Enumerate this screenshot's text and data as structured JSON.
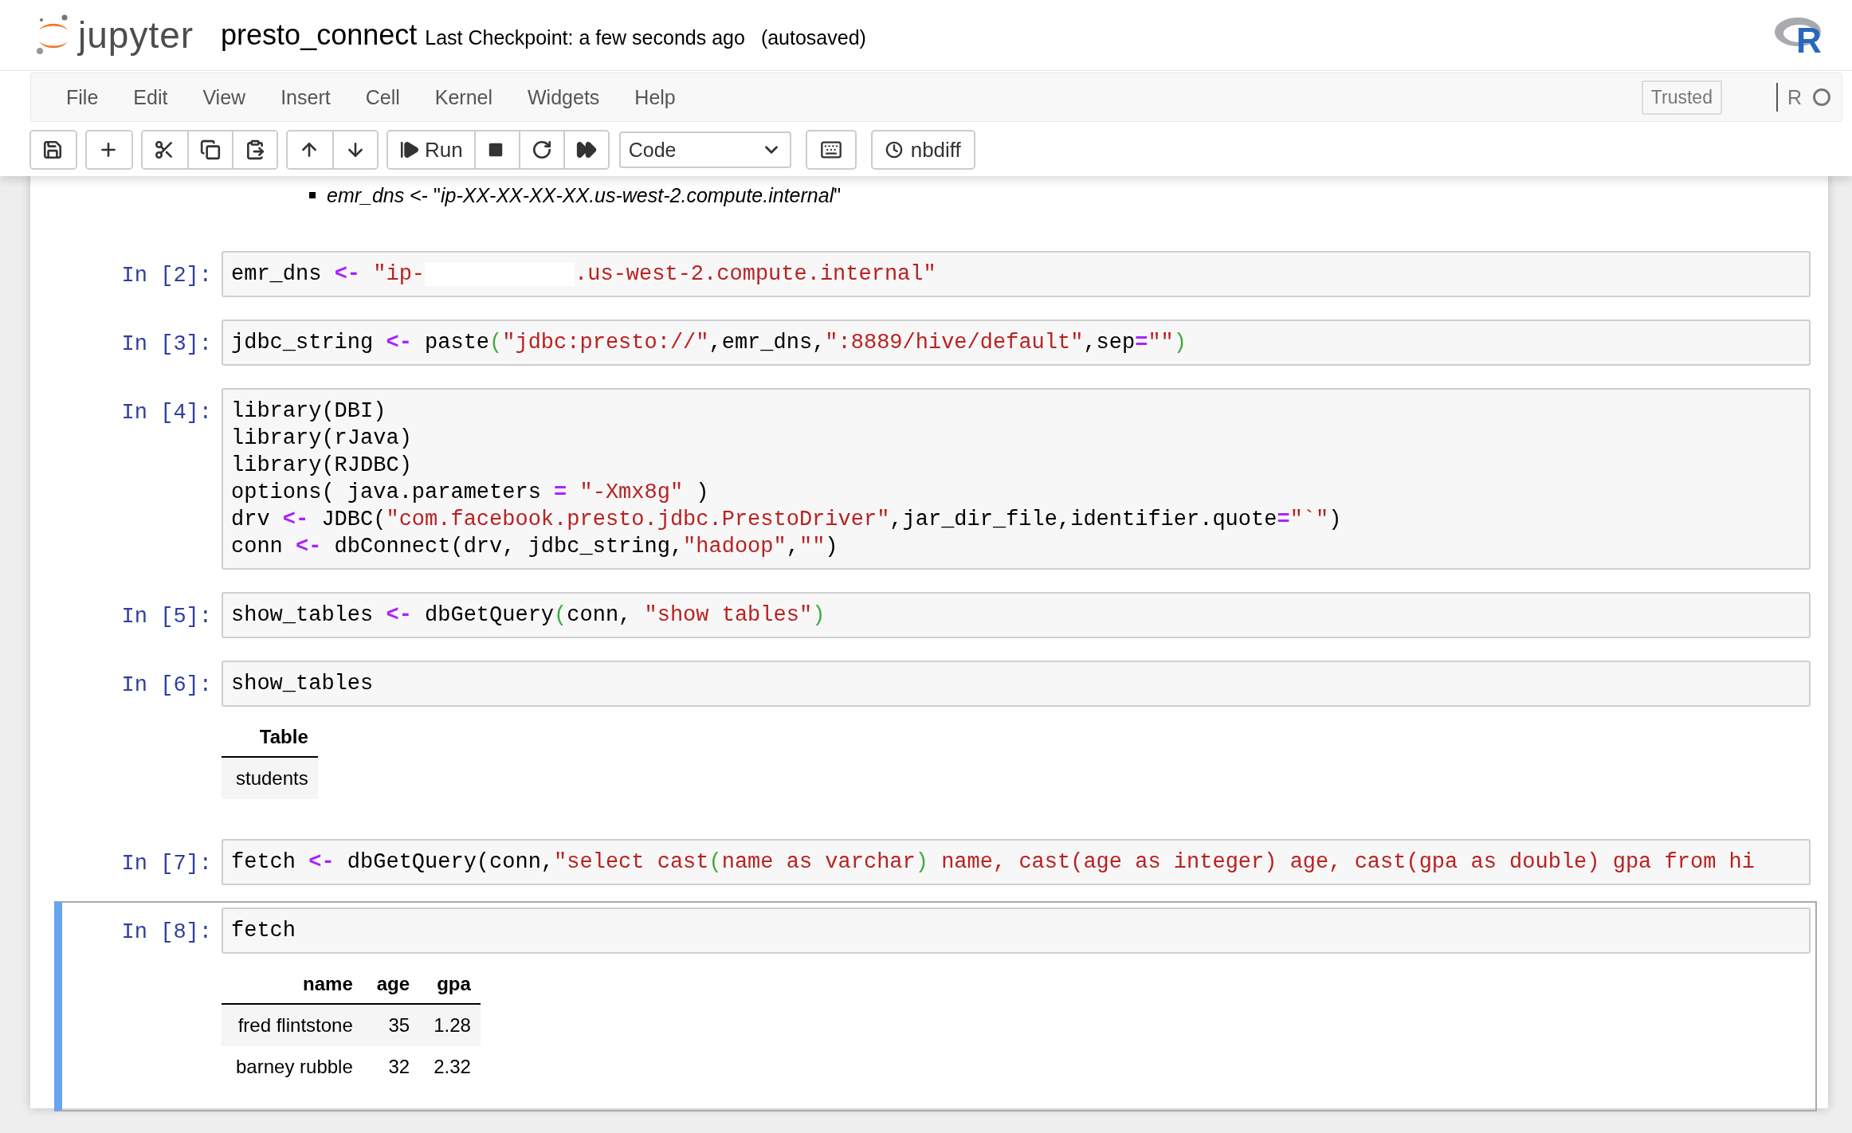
{
  "header": {
    "logo_text": "jupyter",
    "notebook_name": "presto_connect",
    "checkpoint": "Last Checkpoint: a few seconds ago",
    "autosave": "(autosaved)",
    "kernel_logo": {
      "letter": "R"
    }
  },
  "menubar": {
    "items": [
      "File",
      "Edit",
      "View",
      "Insert",
      "Cell",
      "Kernel",
      "Widgets",
      "Help"
    ],
    "trusted": "Trusted",
    "kernel_name": "R",
    "kernel_busy": false
  },
  "toolbar": {
    "groups": [
      [
        {
          "kind": "save"
        }
      ],
      [
        {
          "kind": "add"
        }
      ],
      [
        {
          "kind": "cut"
        },
        {
          "kind": "copy"
        },
        {
          "kind": "paste"
        }
      ],
      [
        {
          "kind": "up"
        },
        {
          "kind": "down"
        }
      ],
      [
        {
          "kind": "run",
          "label": "Run"
        },
        {
          "kind": "stop"
        },
        {
          "kind": "restart"
        },
        {
          "kind": "run_all"
        }
      ]
    ],
    "cell_type": "Code",
    "nbdiff": "nbdiff"
  },
  "markdown": {
    "items": [
      {
        "text": "*emr_dns* <- \"*ip-XX-XX-XX-XX.us-west-2.compute.internal*\""
      }
    ]
  },
  "cells": [
    {
      "prompt": "In [2]:",
      "selected": false,
      "lines": [
        [
          {
            "kind": "plain",
            "text": "emr_dns "
          },
          {
            "kind": "op",
            "text": "<-"
          },
          {
            "kind": "str",
            "text": " \"ip-"
          },
          {
            "kind": "redacted"
          },
          {
            "kind": "str",
            "text": ".us-west-2.compute.internal\""
          }
        ]
      ]
    },
    {
      "prompt": "In [3]:",
      "selected": false,
      "lines": [
        [
          {
            "kind": "plain",
            "text": "jdbc_string "
          },
          {
            "kind": "op",
            "text": "<-"
          },
          {
            "kind": "plain",
            "text": " paste"
          },
          {
            "kind": "paren",
            "text": "("
          },
          {
            "kind": "str",
            "text": "\"jdbc:presto://\""
          },
          {
            "kind": "plain",
            "text": ",emr_dns,"
          },
          {
            "kind": "str",
            "text": "\":8889/hive/default\""
          },
          {
            "kind": "plain",
            "text": ",sep"
          },
          {
            "kind": "op",
            "text": "="
          },
          {
            "kind": "str",
            "text": "\"\""
          },
          {
            "kind": "paren",
            "text": ")"
          }
        ]
      ]
    },
    {
      "prompt": "In [4]:",
      "selected": false,
      "lines": [
        [
          {
            "kind": "plain",
            "text": "library(DBI)"
          }
        ],
        [
          {
            "kind": "plain",
            "text": "library(rJava)"
          }
        ],
        [
          {
            "kind": "plain",
            "text": "library(RJDBC)"
          }
        ],
        [
          {
            "kind": "plain",
            "text": "options( java.parameters "
          },
          {
            "kind": "op",
            "text": "="
          },
          {
            "kind": "str",
            "text": " \"-Xmx8g\""
          },
          {
            "kind": "plain",
            "text": " )"
          }
        ],
        [
          {
            "kind": "plain",
            "text": "drv "
          },
          {
            "kind": "op",
            "text": "<-"
          },
          {
            "kind": "plain",
            "text": " JDBC("
          },
          {
            "kind": "str",
            "text": "\"com.facebook.presto.jdbc.PrestoDriver\""
          },
          {
            "kind": "plain",
            "text": ",jar_dir_file,identifier.quote"
          },
          {
            "kind": "op",
            "text": "="
          },
          {
            "kind": "str",
            "text": "\"`\""
          },
          {
            "kind": "plain",
            "text": ")"
          }
        ],
        [
          {
            "kind": "plain",
            "text": "conn "
          },
          {
            "kind": "op",
            "text": "<-"
          },
          {
            "kind": "plain",
            "text": " dbConnect(drv, jdbc_string,"
          },
          {
            "kind": "str",
            "text": "\"hadoop\""
          },
          {
            "kind": "plain",
            "text": ","
          },
          {
            "kind": "str",
            "text": "\"\""
          },
          {
            "kind": "plain",
            "text": ")"
          }
        ]
      ]
    },
    {
      "prompt": "In [5]:",
      "selected": false,
      "lines": [
        [
          {
            "kind": "plain",
            "text": "show_tables "
          },
          {
            "kind": "op",
            "text": "<-"
          },
          {
            "kind": "plain",
            "text": " dbGetQuery"
          },
          {
            "kind": "paren",
            "text": "("
          },
          {
            "kind": "plain",
            "text": "conn, "
          },
          {
            "kind": "str",
            "text": "\"show tables\""
          },
          {
            "kind": "paren",
            "text": ")"
          }
        ]
      ]
    },
    {
      "prompt": "In [6]:",
      "selected": false,
      "lines": [
        [
          {
            "kind": "plain",
            "text": "show_tables"
          }
        ]
      ],
      "output": {
        "columns": [
          "Table"
        ],
        "rows": [
          [
            "students"
          ]
        ]
      }
    },
    {
      "prompt": "In [7]:",
      "selected": false,
      "lines": [
        [
          {
            "kind": "plain",
            "text": "fetch "
          },
          {
            "kind": "op",
            "text": "<-"
          },
          {
            "kind": "plain",
            "text": " dbGetQuery(conn,"
          },
          {
            "kind": "str",
            "text": "\"select cast"
          },
          {
            "kind": "paren",
            "text": "("
          },
          {
            "kind": "str",
            "text": "name as varchar"
          },
          {
            "kind": "paren",
            "text": ")"
          },
          {
            "kind": "str",
            "text": " name, cast(age as integer) age, cast(gpa as double) gpa from hi"
          }
        ]
      ]
    },
    {
      "prompt": "In [8]:",
      "selected": true,
      "lines": [
        [
          {
            "kind": "plain",
            "text": "fetch"
          }
        ]
      ],
      "output": {
        "columns": [
          "name",
          "age",
          "gpa"
        ],
        "rows": [
          [
            "fred flintstone",
            "35",
            "1.28"
          ],
          [
            "barney rubble",
            "32",
            "2.32"
          ]
        ]
      }
    }
  ]
}
